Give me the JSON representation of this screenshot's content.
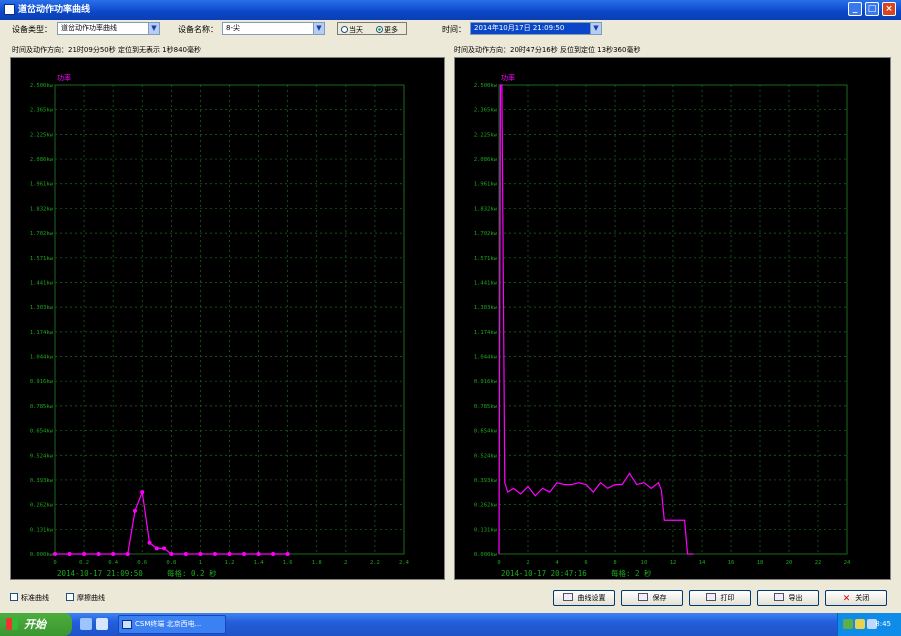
{
  "window": {
    "title": "道岔动作功率曲线"
  },
  "toolbar": {
    "device_type_label": "设备类型：",
    "device_type_value": "道岔动作功率曲线",
    "device_name_label": "设备名称：",
    "device_name_value": "8-尖",
    "radio_today": "当天",
    "radio_more": "更多",
    "time_label": "时间：",
    "time_value": "2014年10月17日 21:09:50"
  },
  "left_info": "时间及动作方向：21时09分50秒  定位到无表示  1秒840毫秒",
  "right_info": "时间及动作方向：20时47分16秒  反位到定位  13秒360毫秒",
  "chart_data": [
    {
      "type": "line",
      "ylabel": "功率",
      "ylim": [
        0,
        2.5
      ],
      "y_ticks": [
        "2.500kw",
        "2.365kw",
        "2.225kw",
        "2.086kw",
        "1.961kw",
        "1.832kw",
        "1.702kw",
        "1.571kw",
        "1.441kw",
        "1.303kw",
        "1.174kw",
        "1.044kw",
        "0.916kw",
        "0.785kw",
        "0.654kw",
        "0.524kw",
        "0.393kw",
        "0.262kw",
        "0.131kw",
        "0.000kw"
      ],
      "x_ticks": [
        "0",
        "0.2",
        "0.4",
        "0.6",
        "0.8",
        "1",
        "1.2",
        "1.4",
        "1.6",
        "1.8",
        "2",
        "2.2",
        "2.4"
      ],
      "xlim": [
        0,
        2.4
      ],
      "footer_time": "2014-10-17  21:09:50",
      "footer_scale": "每格: 0.2 秒",
      "series": [
        {
          "color": "#ff00ff",
          "x": [
            0,
            0.1,
            0.2,
            0.3,
            0.4,
            0.5,
            0.55,
            0.6,
            0.65,
            0.7,
            0.75,
            0.8,
            0.9,
            1.0,
            1.1,
            1.2,
            1.3,
            1.4,
            1.5,
            1.6
          ],
          "y": [
            0,
            0,
            0,
            0,
            0,
            0,
            0.23,
            0.33,
            0.06,
            0.03,
            0.03,
            0,
            0,
            0,
            0,
            0,
            0,
            0,
            0,
            0
          ]
        }
      ]
    },
    {
      "type": "line",
      "ylabel": "功率",
      "ylim": [
        0,
        2.5
      ],
      "y_ticks": [
        "2.500kw",
        "2.365kw",
        "2.225kw",
        "2.086kw",
        "1.961kw",
        "1.832kw",
        "1.702kw",
        "1.571kw",
        "1.441kw",
        "1.303kw",
        "1.174kw",
        "1.044kw",
        "0.916kw",
        "0.785kw",
        "0.654kw",
        "0.524kw",
        "0.393kw",
        "0.262kw",
        "0.131kw",
        "0.000kw"
      ],
      "x_ticks": [
        "0",
        "2",
        "4",
        "6",
        "8",
        "10",
        "12",
        "14",
        "16",
        "18",
        "20",
        "22",
        "24"
      ],
      "xlim": [
        0,
        24
      ],
      "footer_time": "2014-10-17  20:47:16",
      "footer_scale": "每格: 2 秒",
      "series": [
        {
          "color": "#ff00ff",
          "x": [
            0,
            0.1,
            0.2,
            0.4,
            0.6,
            1,
            1.5,
            2,
            2.5,
            3,
            3.5,
            4,
            4.5,
            5,
            5.5,
            6,
            6.5,
            7,
            7.5,
            8,
            8.5,
            9,
            9.5,
            10,
            10.5,
            11,
            11.2,
            11.4,
            11.6,
            12,
            12.4,
            12.8,
            13,
            13.2,
            13.4
          ],
          "y": [
            0,
            2.5,
            2.5,
            0.38,
            0.33,
            0.35,
            0.32,
            0.36,
            0.31,
            0.35,
            0.33,
            0.38,
            0.37,
            0.37,
            0.38,
            0.37,
            0.33,
            0.38,
            0.35,
            0.37,
            0.37,
            0.43,
            0.37,
            0.38,
            0.35,
            0.38,
            0.34,
            0.18,
            0.18,
            0.18,
            0.18,
            0.18,
            0,
            0,
            0
          ]
        }
      ]
    }
  ],
  "bottom": {
    "check_standard": "标准曲线",
    "check_friction": "摩擦曲线",
    "btn_settings": "曲线设置",
    "btn_save": "保存",
    "btn_print": "打印",
    "btn_export": "导出",
    "btn_close": "关闭"
  },
  "taskbar": {
    "start": "开始",
    "task_item": "CSM终端 北京西电...",
    "clock": "8:45"
  },
  "colors": {
    "grid": "#1c6b1c",
    "axis_text": "#1ea81e",
    "curve": "#ff00ff",
    "ylabel": "#ff00ff"
  }
}
